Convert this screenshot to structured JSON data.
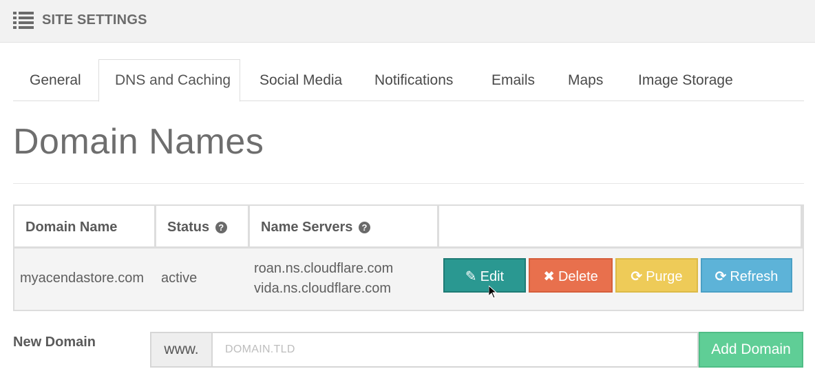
{
  "header": {
    "title": "SITE SETTINGS",
    "icon": "list-icon"
  },
  "tabs": [
    {
      "label": "General",
      "active": false
    },
    {
      "label": "DNS and Caching",
      "active": true
    },
    {
      "label": "Social Media",
      "active": false
    },
    {
      "label": "Notifications",
      "active": false
    },
    {
      "label": "Emails",
      "active": false
    },
    {
      "label": "Maps",
      "active": false
    },
    {
      "label": "Image Storage",
      "active": false
    }
  ],
  "section": {
    "title": "Domain Names"
  },
  "table": {
    "columns": [
      "Domain Name",
      "Status",
      "Name Servers",
      ""
    ],
    "rows": [
      {
        "domain": "myacendastore.com",
        "status": "active",
        "name_servers": [
          "roan.ns.cloudflare.com",
          "vida.ns.cloudflare.com"
        ],
        "actions": {
          "edit": "Edit",
          "delete": "Delete",
          "purge": "Purge",
          "refresh": "Refresh"
        }
      }
    ]
  },
  "new_domain": {
    "label": "New Domain",
    "prefix": "www.",
    "placeholder": "DOMAIN.TLD",
    "value": "",
    "button": "Add Domain"
  },
  "colors": {
    "edit": "#2a9891",
    "delete": "#e8704d",
    "purge": "#eecb58",
    "refresh": "#5db3d8",
    "add": "#5fce96"
  }
}
